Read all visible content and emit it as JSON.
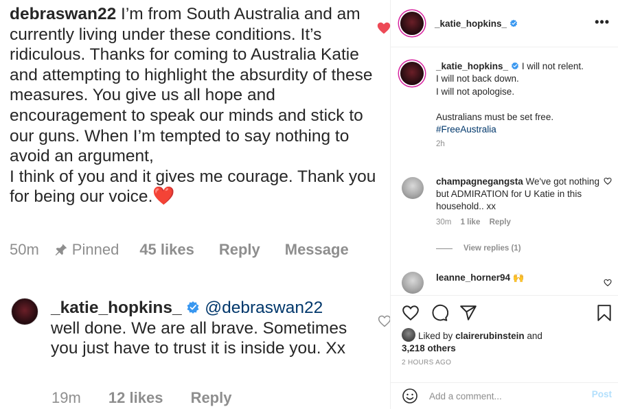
{
  "zoomed": {
    "comment": {
      "username": "debraswan22",
      "text": " I’m from South Australia and am currently living under these conditions. It’s ridiculous. Thanks for coming to Australia Katie and attempting to highlight the absurdity of these measures. You give us all hope and encouragement to speak our minds and stick to our guns.  When I’m tempted to say nothing to avoid an argument,",
      "text2": "I think of you and it gives me courage. Thank you for being our voice.",
      "emoji": "❤️",
      "time": "50m",
      "pinned": "Pinned",
      "likes": "45 likes",
      "reply": "Reply",
      "message": "Message"
    },
    "reply": {
      "username": "_katie_hopkins_",
      "mention": "@debraswan22",
      "text": "well done. We are all brave. Sometimes you just have to trust it is inside you. Xx",
      "time": "19m",
      "likes": "12 likes",
      "reply": "Reply"
    }
  },
  "post": {
    "header": {
      "username": "_katie_hopkins_",
      "more": "•••"
    },
    "caption": {
      "username": "_katie_hopkins_",
      "line1": "I will not relent.",
      "lines": "I will not back down.\nI will not apologise.\n\nAustralians must be set free.",
      "hashtag": "#FreeAustralia",
      "time": "2h"
    },
    "comments": [
      {
        "username": "champagnegangsta",
        "text": "We've got nothing but ADMIRATION for U Katie in this household.. xx",
        "time": "30m",
        "likes": "1 like",
        "reply": "Reply"
      },
      {
        "username": "leanne_horner94",
        "text": "🙌"
      }
    ],
    "view_replies": "View replies (1)",
    "liked_by": {
      "prefix": "Liked by",
      "user": "clairerubinstein",
      "and": "and",
      "others": "3,218 others"
    },
    "posted_ago": "2 HOURS AGO",
    "add_comment": {
      "placeholder": "Add a comment...",
      "post": "Post"
    }
  },
  "icons": [
    "heart-icon",
    "pin-icon",
    "verified-icon",
    "more-icon",
    "comment-icon",
    "share-icon",
    "bookmark-icon",
    "emoji-icon"
  ],
  "colors": {
    "verified": "#3897f0",
    "link": "#00376b",
    "heart": "#ed4956",
    "post_disabled": "#b2dffc"
  }
}
